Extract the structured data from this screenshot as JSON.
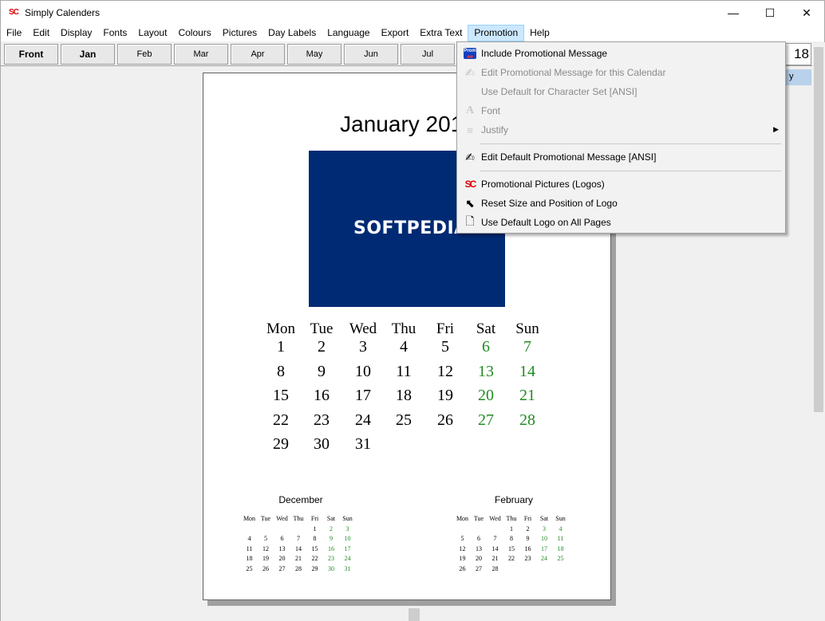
{
  "window": {
    "title": "Simply Calenders",
    "logo_text": "SC"
  },
  "menubar": [
    "File",
    "Edit",
    "Display",
    "Fonts",
    "Layout",
    "Colours",
    "Pictures",
    "Day Labels",
    "Language",
    "Export",
    "Extra Text",
    "Promotion",
    "Help"
  ],
  "toolbar": {
    "tabs": [
      "Front",
      "Jan",
      "Feb",
      "Mar",
      "Apr",
      "May",
      "Jun",
      "Jul"
    ],
    "right_value": "18",
    "right_highlight": "y"
  },
  "page": {
    "month_title": "January 2018",
    "logo_text": "SOFTPEDIA",
    "weekday_headers": [
      "Mon",
      "Tue",
      "Wed",
      "Thu",
      "Fri",
      "Sat",
      "Sun"
    ],
    "weeks": [
      [
        "1",
        "2",
        "3",
        "4",
        "5",
        "6",
        "7"
      ],
      [
        "8",
        "9",
        "10",
        "11",
        "12",
        "13",
        "14"
      ],
      [
        "15",
        "16",
        "17",
        "18",
        "19",
        "20",
        "21"
      ],
      [
        "22",
        "23",
        "24",
        "25",
        "26",
        "27",
        "28"
      ],
      [
        "29",
        "30",
        "31",
        "",
        "",
        "",
        ""
      ]
    ],
    "mini_calendars": [
      {
        "title": "December",
        "headers": [
          "Mon",
          "Tue",
          "Wed",
          "Thu",
          "Fri",
          "Sat",
          "Sun"
        ],
        "weeks": [
          [
            "",
            "",
            "",
            "",
            "1",
            "2",
            "3"
          ],
          [
            "4",
            "5",
            "6",
            "7",
            "8",
            "9",
            "10"
          ],
          [
            "11",
            "12",
            "13",
            "14",
            "15",
            "16",
            "17"
          ],
          [
            "18",
            "19",
            "20",
            "21",
            "22",
            "23",
            "24"
          ],
          [
            "25",
            "26",
            "27",
            "28",
            "29",
            "30",
            "31"
          ]
        ]
      },
      {
        "title": "February",
        "headers": [
          "Mon",
          "Tue",
          "Wed",
          "Thu",
          "Fri",
          "Sat",
          "Sun"
        ],
        "weeks": [
          [
            "",
            "",
            "",
            "1",
            "2",
            "3",
            "4"
          ],
          [
            "5",
            "6",
            "7",
            "8",
            "9",
            "10",
            "11"
          ],
          [
            "12",
            "13",
            "14",
            "15",
            "16",
            "17",
            "18"
          ],
          [
            "19",
            "20",
            "21",
            "22",
            "23",
            "24",
            "25"
          ],
          [
            "26",
            "27",
            "28",
            "",
            "",
            "",
            ""
          ]
        ]
      }
    ]
  },
  "promotion_menu": {
    "items": [
      {
        "label": "Include Promotional Message",
        "icon": "prom-icon",
        "enabled": true
      },
      {
        "label": "Edit Promotional Message for this Calendar",
        "icon": "edit-hand-icon",
        "enabled": false
      },
      {
        "label": "Use Default for Character Set [ANSI]",
        "icon": "",
        "enabled": false
      },
      {
        "label": "Font",
        "icon": "font-icon",
        "enabled": false
      },
      {
        "label": "Justify",
        "icon": "justify-icon",
        "enabled": false,
        "submenu": true
      },
      {
        "label": "Edit Default Promotional Message [ANSI]",
        "icon": "edit-hand-icon",
        "enabled": true
      },
      {
        "label": "Promotional Pictures (Logos)",
        "icon": "sc-logo-icon",
        "enabled": true
      },
      {
        "label": "Reset Size and Position of Logo",
        "icon": "reset-position-icon",
        "enabled": true
      },
      {
        "label": "Use Default Logo on All Pages",
        "icon": "page-icon",
        "enabled": true
      }
    ]
  },
  "colors": {
    "weekend": "#228b22",
    "logo_bg": "#002a73",
    "menu_highlight": "#cce8ff"
  }
}
